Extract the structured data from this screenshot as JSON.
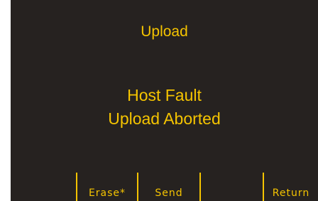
{
  "screen": {
    "title": "Upload",
    "message_line1": "Host Fault",
    "message_line2": "Upload Aborted"
  },
  "softkeys": {
    "erase_label": "Erase*",
    "send_label": "Send",
    "blank_label": "",
    "return_label": "Return"
  },
  "colors": {
    "background": "#262220",
    "text": "#f5c400"
  }
}
